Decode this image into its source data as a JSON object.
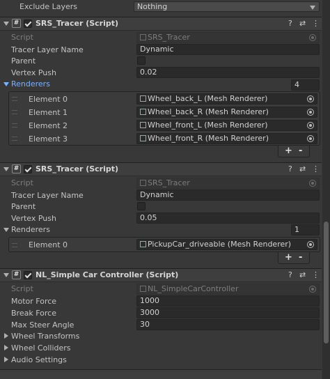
{
  "exclude_layers": {
    "label": "Exclude Layers",
    "value": "Nothing"
  },
  "tracer1": {
    "title": "SRS_Tracer (Script)",
    "script_label": "Script",
    "script_value": "SRS_Tracer",
    "layer_label": "Tracer Layer Name",
    "layer_value": "Dynamic",
    "parent_label": "Parent",
    "push_label": "Vertex Push",
    "push_value": "0.02",
    "renderers_label": "Renderers",
    "renderers_count": "4",
    "elements": [
      {
        "label": "Element 0",
        "value": "Wheel_back_L (Mesh Renderer)"
      },
      {
        "label": "Element 1",
        "value": "Wheel_back_R (Mesh Renderer)"
      },
      {
        "label": "Element 2",
        "value": "Wheel_front_L (Mesh Renderer)"
      },
      {
        "label": "Element 3",
        "value": "Wheel_front_R (Mesh Renderer)"
      }
    ],
    "add": "+",
    "remove": "-"
  },
  "tracer2": {
    "title": "SRS_Tracer (Script)",
    "script_label": "Script",
    "script_value": "SRS_Tracer",
    "layer_label": "Tracer Layer Name",
    "layer_value": "Dynamic",
    "parent_label": "Parent",
    "push_label": "Vertex Push",
    "push_value": "0.05",
    "renderers_label": "Renderers",
    "renderers_count": "1",
    "elements": [
      {
        "label": "Element 0",
        "value": "PickupCar_driveable (Mesh Renderer)"
      }
    ],
    "add": "+",
    "remove": "-"
  },
  "car": {
    "title": "NL_Simple Car Controller (Script)",
    "script_label": "Script",
    "script_value": "NL_SimpleCarController",
    "motor_label": "Motor Force",
    "motor_value": "1000",
    "break_label": "Break Force",
    "break_value": "3000",
    "steer_label": "Max Steer Angle",
    "steer_value": "30",
    "wheel_transforms": "Wheel Transforms",
    "wheel_colliders": "Wheel Colliders",
    "audio_settings": "Audio Settings"
  },
  "icons": {
    "help": "?",
    "settings": "⇄",
    "more": "⋮",
    "script": "#"
  },
  "colors": {
    "background": "#383838",
    "header": "#3e3e3e",
    "field": "#2a2a2a",
    "accent": "#7bb1ff"
  }
}
